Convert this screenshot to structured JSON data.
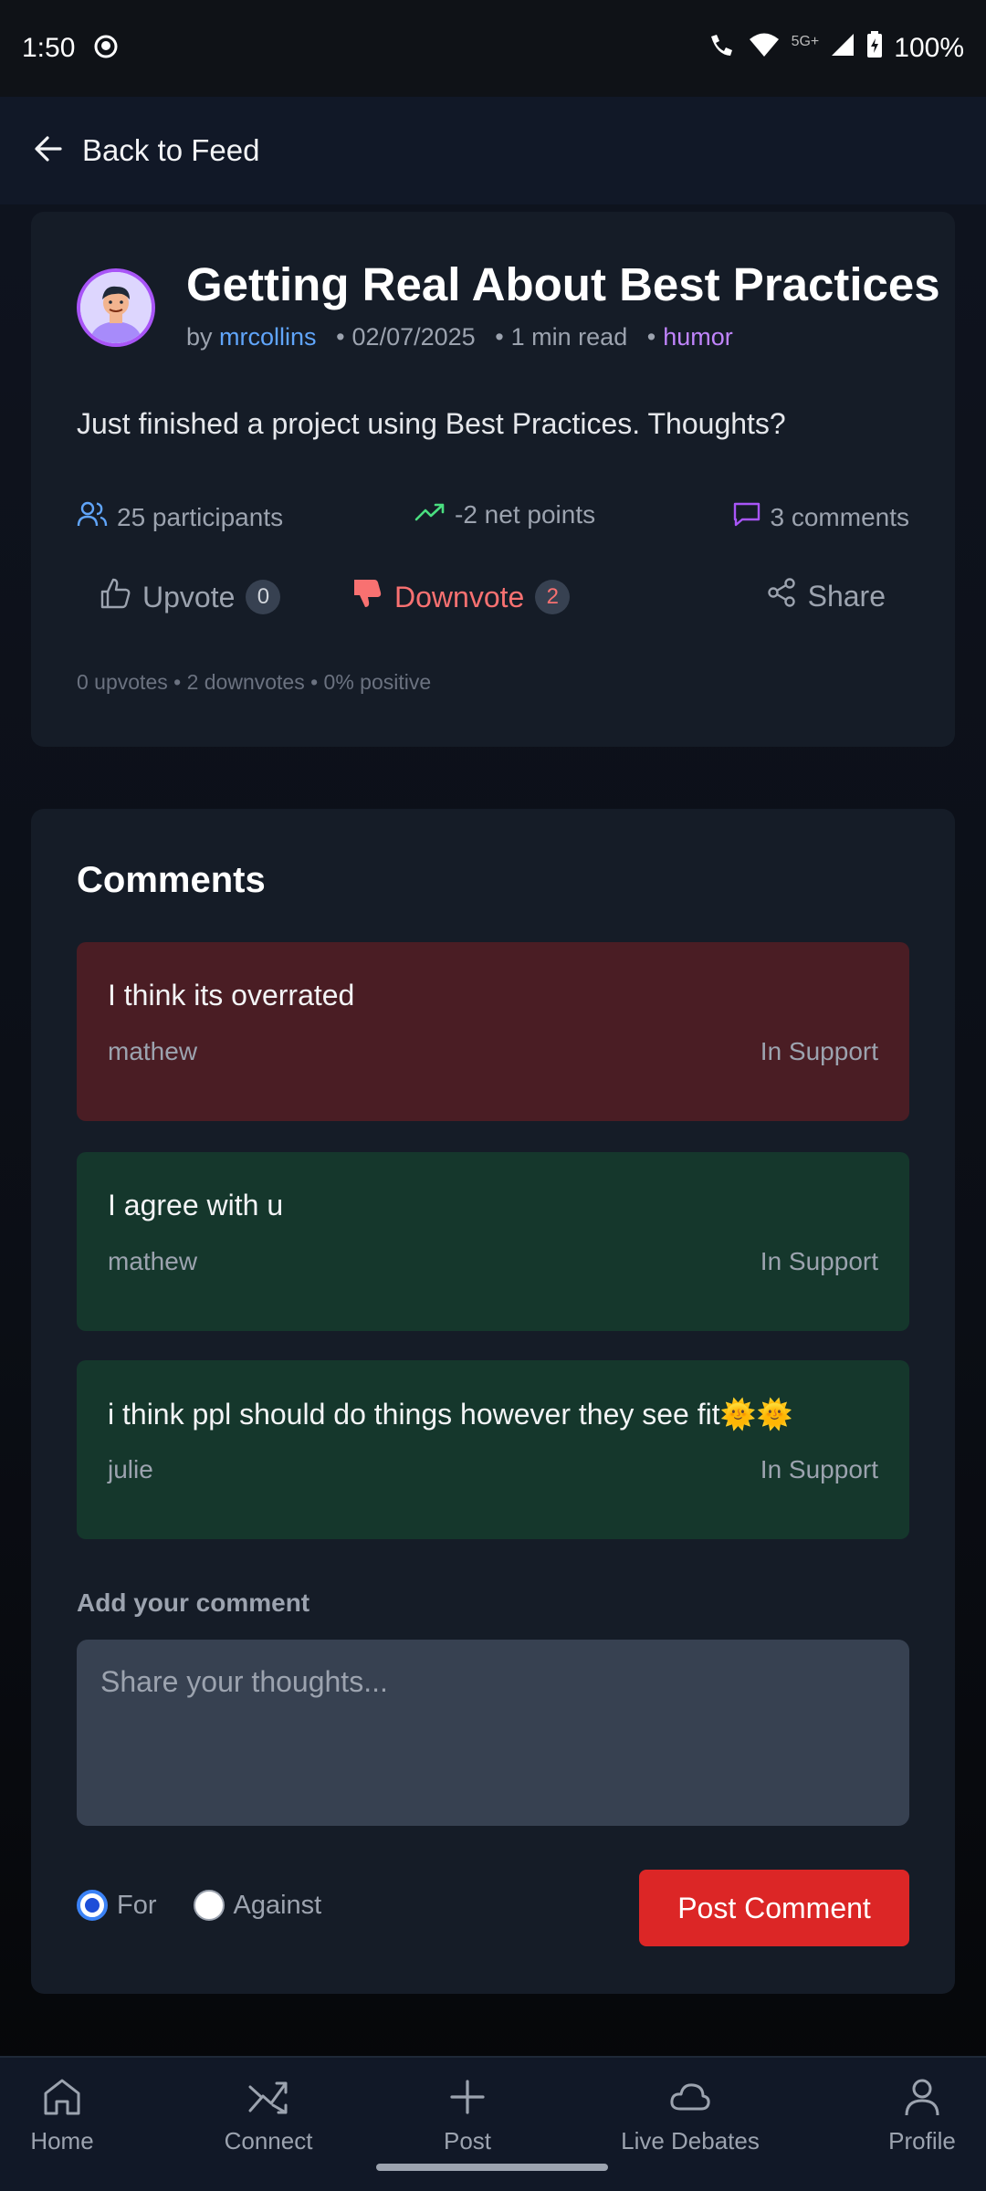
{
  "status_bar": {
    "time": "1:50",
    "network": "5G+",
    "battery": "100%"
  },
  "topbar": {
    "back_label": "Back to Feed"
  },
  "post": {
    "title": "Getting Real About Best Practices",
    "by": "by",
    "author": "mrcollins",
    "date": "02/07/2025",
    "read_time": "1 min read",
    "tag": "humor",
    "body": "Just finished a project using Best Practices. Thoughts?",
    "stats": {
      "participants": "25 participants",
      "net_points": "-2 net points",
      "comments": "3 comments"
    },
    "actions": {
      "upvote_label": "Upvote",
      "upvote_count": "0",
      "downvote_label": "Downvote",
      "downvote_count": "2",
      "share_label": "Share"
    },
    "summary": "0 upvotes • 2 downvotes • 0% positive"
  },
  "comments_section": {
    "title": "Comments",
    "items": [
      {
        "text": "I think its overrated",
        "author": "mathew",
        "stance": "In Support",
        "tone": "against"
      },
      {
        "text": "I agree with u",
        "author": "mathew",
        "stance": "In Support",
        "tone": "for"
      },
      {
        "text": "i think ppl should do things however they see fit🌞🌞",
        "author": "julie",
        "stance": "In Support",
        "tone": "for"
      }
    ],
    "add_label": "Add your comment",
    "placeholder": "Share your thoughts...",
    "radio_for": "For",
    "radio_against": "Against",
    "selected_side": "For",
    "post_button": "Post Comment"
  },
  "colors": {
    "accent_blue": "#60a5fa",
    "tag_purple": "#c084fc",
    "downvote_red": "#f87171",
    "post_button_red": "#dc2626",
    "trend_green": "#4ade80",
    "comment_against_bg": "#4a1d24",
    "comment_for_bg": "#15372c"
  },
  "bottom_nav": [
    {
      "label": "Home",
      "icon": "home-icon"
    },
    {
      "label": "Connect",
      "icon": "shuffle-icon"
    },
    {
      "label": "Post",
      "icon": "plus-icon"
    },
    {
      "label": "Live Debates",
      "icon": "cloud-icon"
    },
    {
      "label": "Profile",
      "icon": "user-icon"
    }
  ]
}
